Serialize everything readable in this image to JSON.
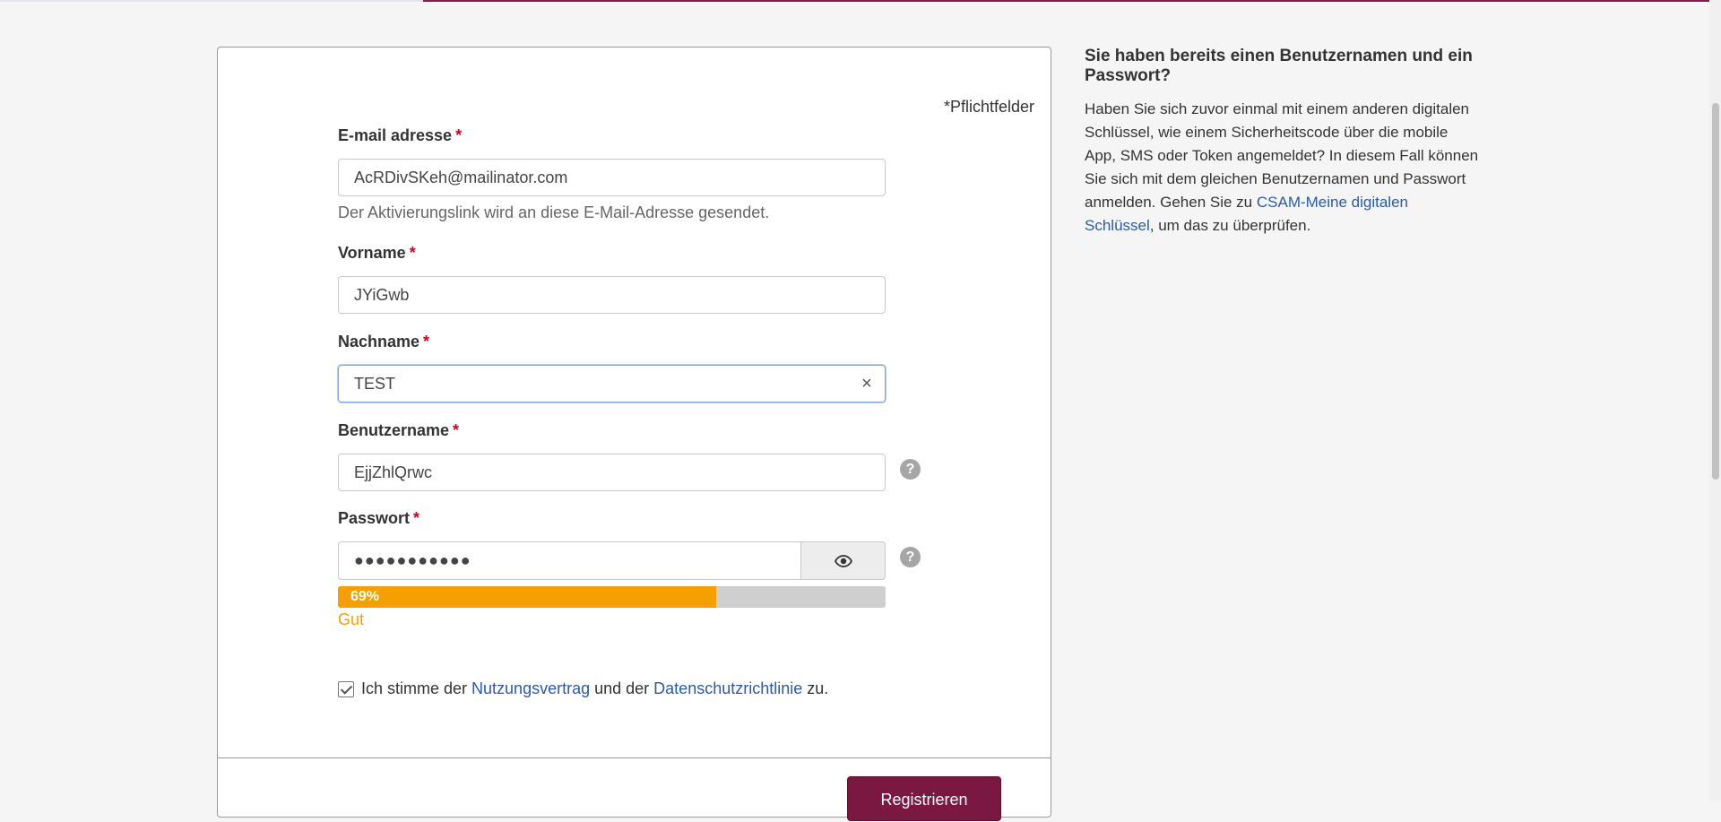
{
  "form": {
    "required_note": "*Pflichtfelder",
    "required_star": "*",
    "email": {
      "label": "E-mail adresse",
      "value": "AcRDivSKeh@mailinator.com",
      "hint": "Der Aktivierungslink wird an diese E-Mail-Adresse gesendet."
    },
    "firstname": {
      "label": "Vorname",
      "value": "JYiGwb"
    },
    "lastname": {
      "label": "Nachname",
      "value": "TEST",
      "clear_icon": "×"
    },
    "username": {
      "label": "Benutzername",
      "value": "EjjZhlQrwc",
      "help_icon": "?"
    },
    "password": {
      "label": "Passwort",
      "value": "●●●●●●●●●●●",
      "help_icon": "?",
      "toggle_icon": "eye-icon",
      "strength_percent": 69,
      "strength_text": "69%",
      "strength_label": "Gut",
      "strength_color": "#f5a000"
    },
    "agree": {
      "prefix": "Ich stimme der ",
      "link1": "Nutzungsvertrag",
      "middle": " und der ",
      "link2": "Datenschutzrichtlinie",
      "suffix": " zu.",
      "checked": true
    },
    "submit_label": "Registrieren"
  },
  "sidebar": {
    "title": "Sie haben bereits einen Benutzernamen und ein Passwort?",
    "text_before_link": "Haben Sie sich zuvor einmal mit einem anderen digitalen Schlüssel, wie einem Sicherheitscode über die mobile App, SMS oder Token angemeldet? In diesem Fall können Sie sich mit dem gleichen Benutzernamen und Passwort anmelden. Gehen Sie zu ",
    "link": "CSAM-Meine digitalen Schlüssel",
    "text_after_link": ", um das zu überprüfen."
  },
  "colors": {
    "brand": "#7a1842",
    "link": "#2b5aa8",
    "required": "#d0021b"
  }
}
